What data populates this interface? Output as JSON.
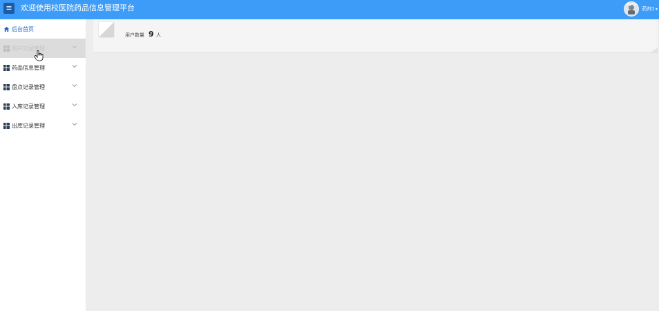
{
  "header": {
    "title": "欢迎使用校医院药品信息管理平台",
    "menu_icon": "hamburger-icon",
    "user_name": "药剂1",
    "avatar_icon": "avatar-image",
    "caret_icon": "caret-down-icon",
    "bg_color": "#3d9cf7"
  },
  "sidebar": {
    "items": [
      {
        "label": "后台首页",
        "icon": "home-icon",
        "expandable": false
      },
      {
        "label": "用户记录管理",
        "icon": "grid-icon",
        "expandable": true,
        "state": "hovered"
      },
      {
        "label": "药品信息管理",
        "icon": "grid-icon",
        "expandable": true
      },
      {
        "label": "盘点记录管理",
        "icon": "grid-icon",
        "expandable": true
      },
      {
        "label": "入库记录管理",
        "icon": "grid-icon",
        "expandable": true
      },
      {
        "label": "出库记录管理",
        "icon": "grid-icon",
        "expandable": true
      }
    ]
  },
  "dashboard": {
    "stat_label": "用户数量",
    "stat_value": "9",
    "stat_unit": "人",
    "thumb_icon": "image-thumbnail-icon"
  }
}
